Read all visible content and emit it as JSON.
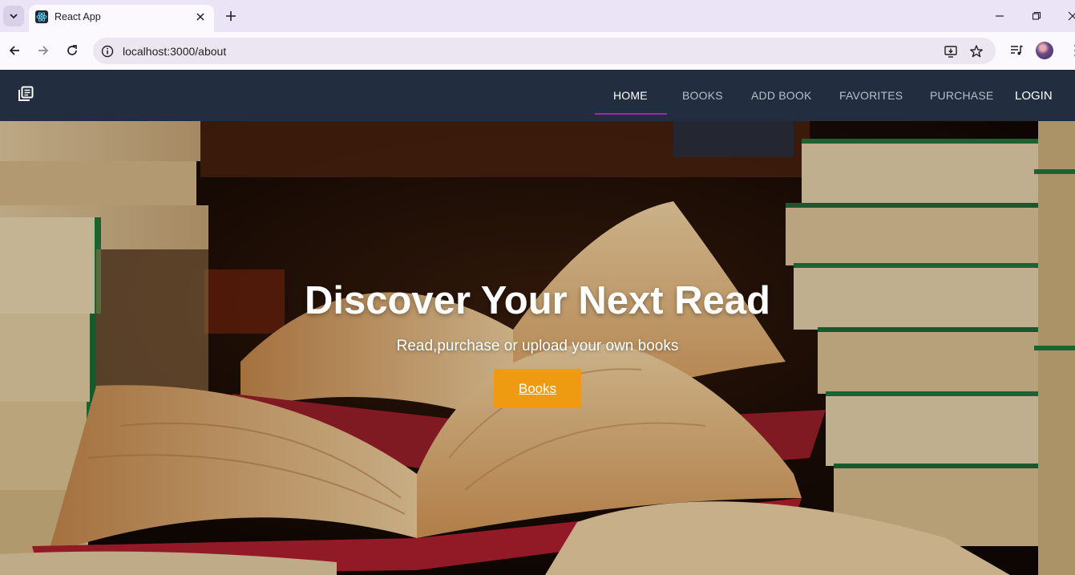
{
  "browser": {
    "tab_title": "React App",
    "url": "localhost:3000/about"
  },
  "navbar": {
    "links": [
      {
        "label": "HOME",
        "active": true
      },
      {
        "label": "BOOKS",
        "active": false
      },
      {
        "label": "ADD BOOK",
        "active": false
      },
      {
        "label": "FAVORITES",
        "active": false
      },
      {
        "label": "PURCHASE",
        "active": false
      }
    ],
    "login_label": "LOGIN",
    "active_color": "#9c27b0"
  },
  "hero": {
    "title": "Discover Your Next Read",
    "subtitle": "Read,purchase or upload your own books",
    "button_label": "Books",
    "button_color": "#ee9b12"
  },
  "colors": {
    "navbar_bg": "#222e3f",
    "tabbar_bg": "#ebe3f6",
    "toolbar_bg": "#fbf8fe"
  }
}
